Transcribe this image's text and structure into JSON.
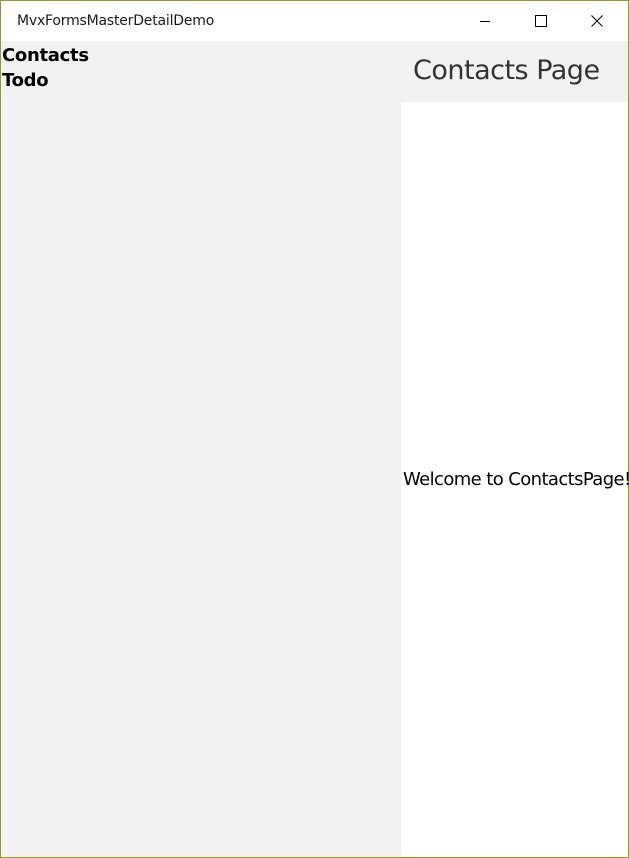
{
  "window": {
    "title": "MvxFormsMasterDetailDemo",
    "controls": {
      "minimize_icon": "minimize-icon",
      "maximize_icon": "maximize-icon",
      "close_icon": "close-icon"
    }
  },
  "master": {
    "items": [
      {
        "label": "Contacts"
      },
      {
        "label": "Todo"
      }
    ]
  },
  "detail": {
    "page_title": "Contacts Page",
    "welcome_text": "Welcome to ContactsPage!"
  },
  "colors": {
    "window_border": "#a0922a",
    "master_background": "#f2f2f2",
    "detail_background": "#ffffff",
    "header_background": "#f2f2f2"
  }
}
